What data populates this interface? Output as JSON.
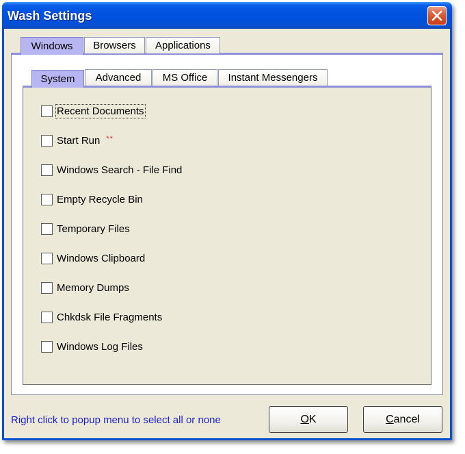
{
  "window": {
    "title": "Wash Settings"
  },
  "outer_tabs": [
    {
      "label": "Windows",
      "active": true
    },
    {
      "label": "Browsers",
      "active": false
    },
    {
      "label": "Applications",
      "active": false
    }
  ],
  "inner_tabs": [
    {
      "label": "System",
      "active": true
    },
    {
      "label": "Advanced",
      "active": false
    },
    {
      "label": "MS Office",
      "active": false
    },
    {
      "label": "Instant Messengers",
      "active": false
    }
  ],
  "system_options": [
    {
      "label": "Recent Documents",
      "checked": false,
      "focused": true
    },
    {
      "label": "Start Run",
      "checked": false,
      "marker": "**"
    },
    {
      "label": "Windows Search - File Find",
      "checked": false
    },
    {
      "label": "Empty Recycle Bin",
      "checked": false
    },
    {
      "label": "Temporary Files",
      "checked": false
    },
    {
      "label": "Windows Clipboard",
      "checked": false
    },
    {
      "label": "Memory Dumps",
      "checked": false
    },
    {
      "label": "Chkdsk File Fragments",
      "checked": false
    },
    {
      "label": "Windows Log Files",
      "checked": false
    }
  ],
  "footer": {
    "hint": "Right click to popup menu to select all or none",
    "ok": {
      "mnemonic": "O",
      "rest": "K"
    },
    "cancel": {
      "mnemonic": "C",
      "rest": "ancel"
    }
  },
  "colors": {
    "title_bar": "#0053e1",
    "active_tab": "#b8b6f2",
    "hint_text": "#1d1dc8",
    "marker": "#d23030"
  },
  "icons": {
    "close": "close-icon"
  }
}
